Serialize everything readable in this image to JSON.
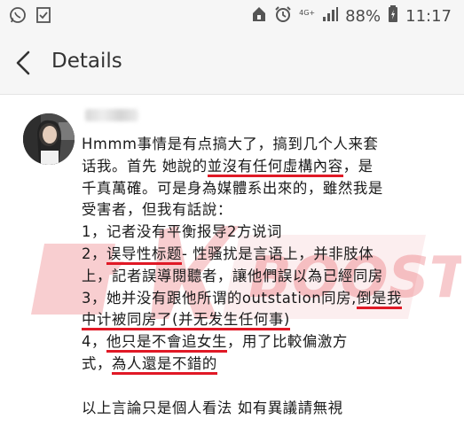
{
  "status_bar": {
    "network": "4G+",
    "battery": "88%",
    "time": "11:17"
  },
  "header": {
    "title": "Details"
  },
  "watermark_text": "BOOST",
  "post": {
    "lines": [
      [
        {
          "t": "Hmmm事情是有点搞大了，搞到几个人来套",
          "h": false
        }
      ],
      [
        {
          "t": "话我。首先 她說的",
          "h": false
        },
        {
          "t": "並沒有任何虛構內容",
          "h": true
        },
        {
          "t": "，是",
          "h": false
        }
      ],
      [
        {
          "t": "千真萬確。可是身為媒體系出來的，雖然我是",
          "h": false
        }
      ],
      [
        {
          "t": "受害者，但我有話說：",
          "h": false
        }
      ],
      [
        {
          "t": "1，记者没有平衡报导2方说词",
          "h": false
        }
      ],
      [
        {
          "t": "2，",
          "h": false
        },
        {
          "t": "误导性标题",
          "h": true
        },
        {
          "t": "- 性骚扰是言语上，并非肢体",
          "h": false
        }
      ],
      [
        {
          "t": "上，記者誤導閱聽者，讓他們誤以為已經同房",
          "h": false
        }
      ],
      [
        {
          "t": "3，她并没有跟他所谓的outstation同房,",
          "h": false
        },
        {
          "t": "倒是我",
          "h": true
        }
      ],
      [
        {
          "t": "中计被同房了(并无发生任何事)",
          "h": true
        }
      ],
      [
        {
          "t": "4，",
          "h": false
        },
        {
          "t": "他只是不會追女生",
          "h": true
        },
        {
          "t": "，用了比較偏激方",
          "h": false
        }
      ],
      [
        {
          "t": "式，",
          "h": false
        },
        {
          "t": "為人還是不錯的",
          "h": true
        }
      ],
      [],
      [
        {
          "t": "以上言論只是個人看法 如有異議請無視",
          "h": false
        }
      ]
    ]
  },
  "colors": {
    "highlight": "#e01926",
    "watermark": "#e8535b"
  }
}
